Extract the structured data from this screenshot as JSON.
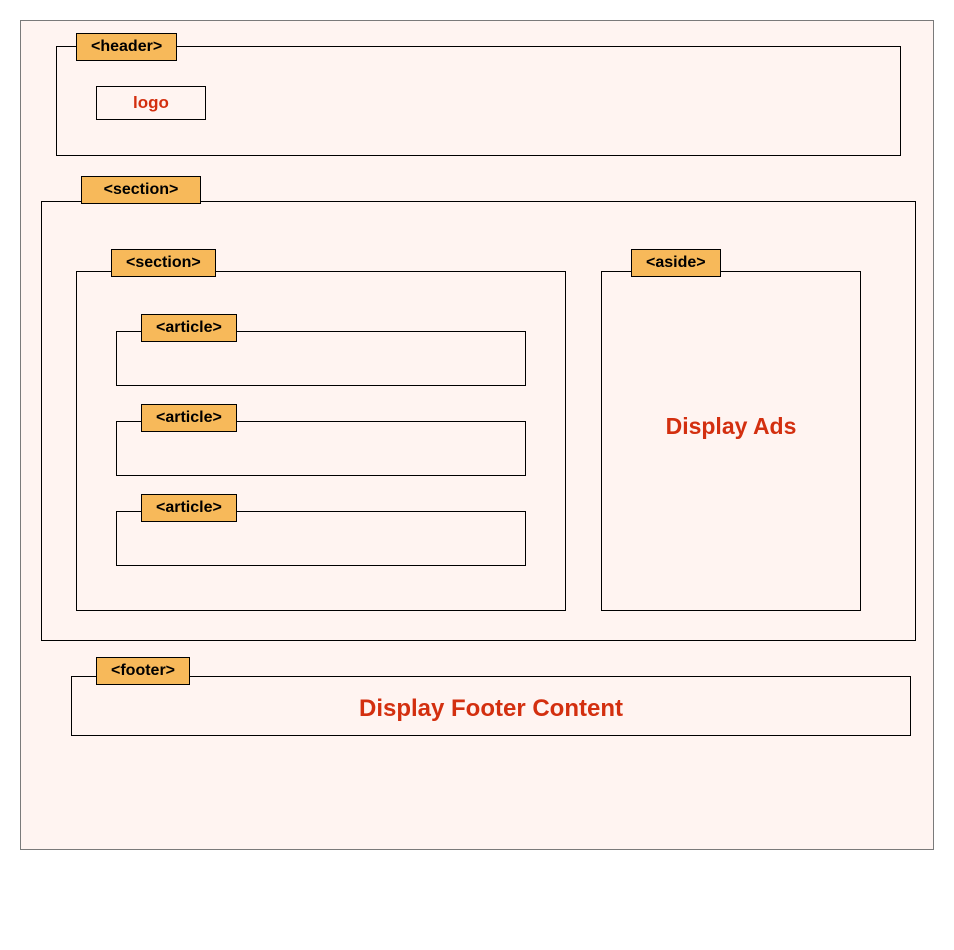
{
  "tags": {
    "header": "<header>",
    "section_outer": "<section>",
    "section_inner": "<section>",
    "article1": "<article>",
    "article2": "<article>",
    "article3": "<article>",
    "aside": "<aside>",
    "footer": "<footer>"
  },
  "content": {
    "logo": "logo",
    "aside_text": "Display Ads",
    "footer_text": "Display Footer Content"
  },
  "colors": {
    "tag_bg": "#f7b95a",
    "accent_text": "#d32f0f",
    "canvas_bg": "#fff4f1"
  }
}
